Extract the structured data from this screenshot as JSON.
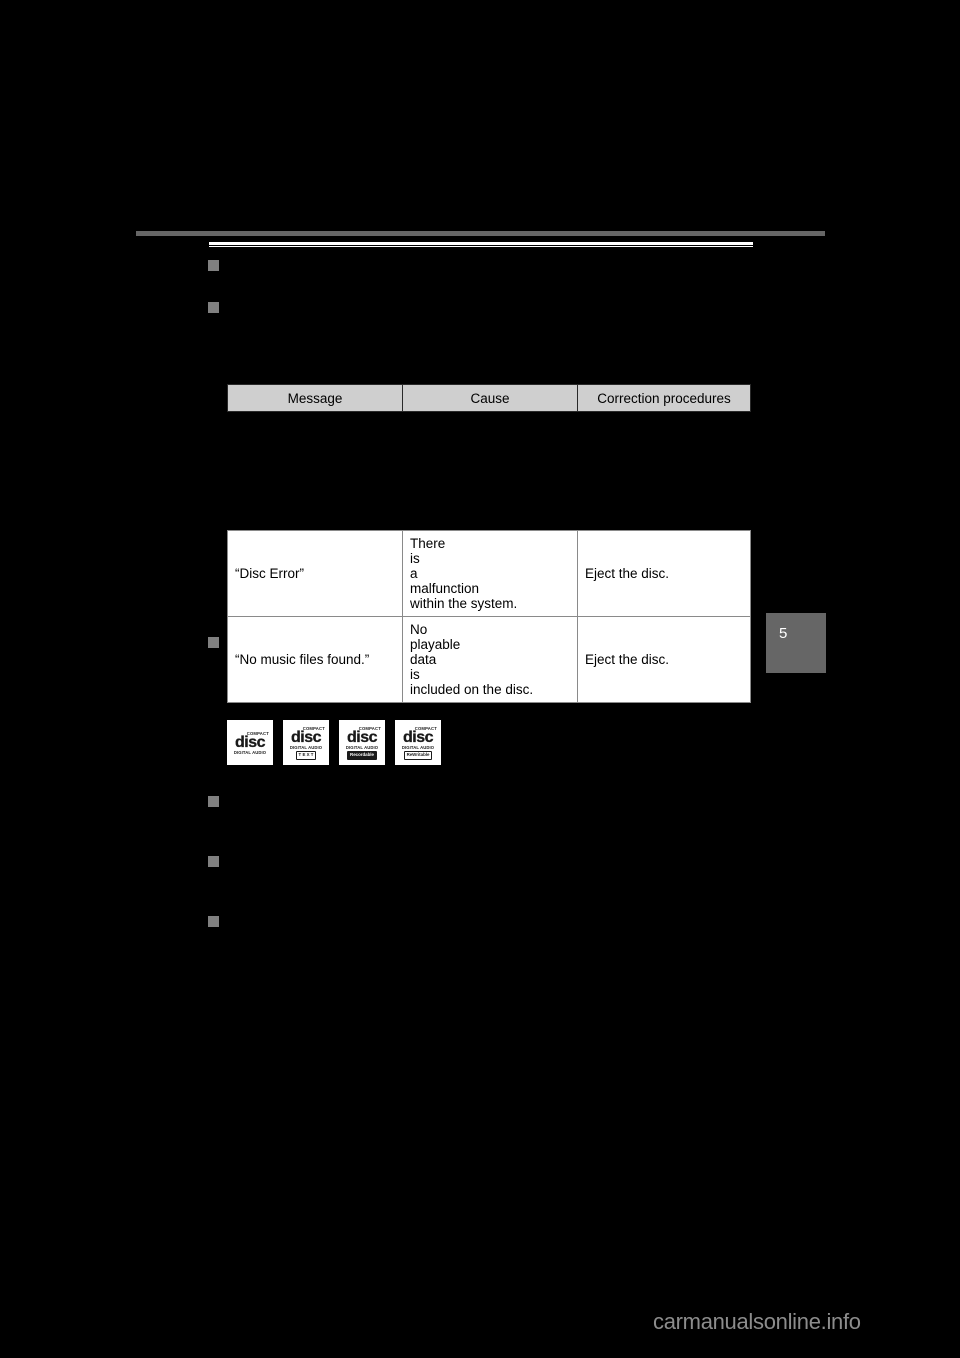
{
  "page": {
    "background_color": "#000000",
    "chapter_tab": {
      "number": "5",
      "color": "#666666",
      "text_color": "#ffffff"
    },
    "watermark": {
      "text": "carmanualsonline.info",
      "color": "#8c8c8c"
    },
    "rules": {
      "header_gray_color": "#666666",
      "header_white_color": "#ffffff"
    },
    "heading": {
      "text": ""
    }
  },
  "sections": [
    {
      "id": "section-1",
      "bullet_color": "#808080",
      "body": ""
    },
    {
      "id": "section-2",
      "bullet_color": "#808080",
      "body": ""
    },
    {
      "id": "section-3",
      "bullet_color": "#808080",
      "body": ""
    },
    {
      "id": "section-4",
      "bullet_color": "#808080",
      "body": ""
    },
    {
      "id": "section-5",
      "bullet_color": "#808080",
      "body": ""
    },
    {
      "id": "section-6",
      "bullet_color": "#808080",
      "body": ""
    }
  ],
  "table": {
    "header_background": "#cfcfcf",
    "row_background": "#ffffff",
    "columns": [
      "Message",
      "Cause",
      "Correction procedures"
    ],
    "rows": [
      {
        "message": "“Disc Error”",
        "cause_line_1": [
          "There",
          "is",
          "a",
          "malfunction"
        ],
        "cause_line_2": "within the system.",
        "correction": "Eject the disc."
      },
      {
        "message": "“No music files found.”",
        "cause_line_1": [
          "No",
          "playable",
          "data",
          "is"
        ],
        "cause_line_2": "included on the disc.",
        "correction": "Eject the disc."
      }
    ]
  },
  "cd_logos": [
    {
      "id": "cd-audio",
      "top_text": "COMPACT",
      "word": "disc",
      "sub_text": "DIGITAL AUDIO",
      "badge": null,
      "badge_inverted": false
    },
    {
      "id": "cd-text",
      "top_text": "COMPACT",
      "word": "disc",
      "sub_text": "DIGITAL AUDIO",
      "badge": "T E X T",
      "badge_inverted": false
    },
    {
      "id": "cd-recordable",
      "top_text": "COMPACT",
      "word": "disc",
      "sub_text": "DIGITAL AUDIO",
      "badge": "Recordable",
      "badge_inverted": true
    },
    {
      "id": "cd-rewritable",
      "top_text": "COMPACT",
      "word": "disc",
      "sub_text": "DIGITAL AUDIO",
      "badge": "ReWritable",
      "badge_inverted": false
    }
  ]
}
